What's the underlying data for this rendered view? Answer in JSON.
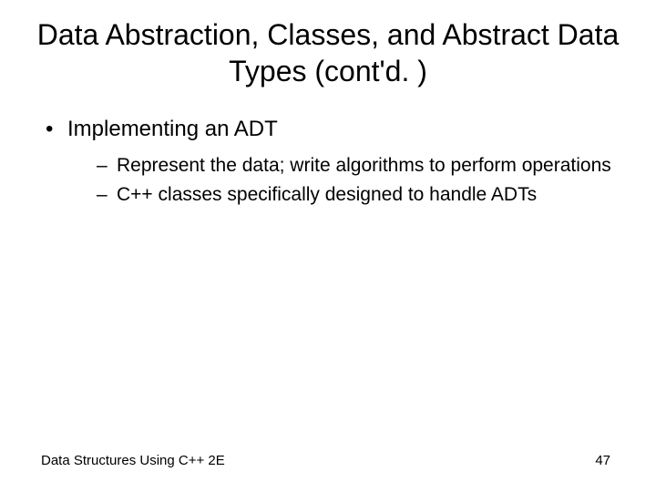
{
  "title": "Data Abstraction, Classes, and Abstract Data Types (cont'd. )",
  "bullets": {
    "l1": "Implementing an ADT",
    "l2a": "Represent the data; write algorithms to perform operations",
    "l2b": "C++ classes specifically designed to handle ADTs"
  },
  "footer": {
    "left": "Data Structures Using C++ 2E",
    "right": "47"
  }
}
